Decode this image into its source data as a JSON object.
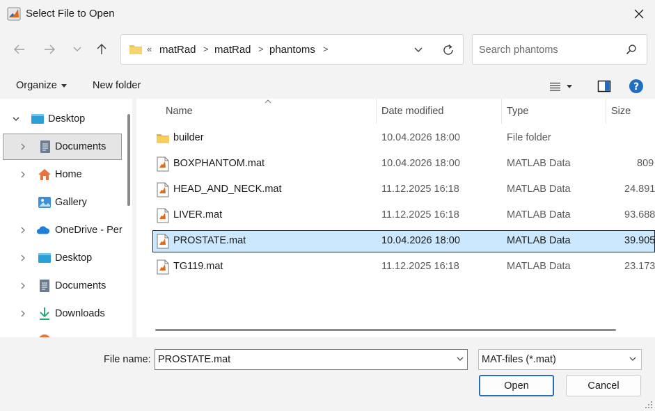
{
  "window": {
    "title": "Select File to Open"
  },
  "address": {
    "overflow": "«",
    "crumbs": [
      "matRad",
      "matRad",
      "phantoms"
    ],
    "separator": ">"
  },
  "search": {
    "placeholder": "Search phantoms"
  },
  "toolbar": {
    "organize_label": "Organize",
    "new_folder_label": "New folder"
  },
  "nav": {
    "items": [
      {
        "label": "Desktop",
        "icon": "desktop-icon",
        "expanded": true
      },
      {
        "label": "Documents",
        "icon": "documents-icon",
        "selected": true
      },
      {
        "label": "Home",
        "icon": "home-icon"
      },
      {
        "label": "Gallery",
        "icon": "gallery-icon"
      },
      {
        "label": "OneDrive - Per",
        "icon": "onedrive-icon"
      },
      {
        "label": "Desktop",
        "icon": "desktop-icon"
      },
      {
        "label": "Documents",
        "icon": "documents-icon"
      },
      {
        "label": "Downloads",
        "icon": "downloads-icon"
      }
    ]
  },
  "columns": {
    "name": "Name",
    "date": "Date modified",
    "type": "Type",
    "size": "Size"
  },
  "files": [
    {
      "name": "builder",
      "date": "10.04.2026 18:00",
      "type": "File folder",
      "size": "",
      "icon": "folder-icon"
    },
    {
      "name": "BOXPHANTOM.mat",
      "date": "10.04.2026 18:00",
      "type": "MATLAB Data",
      "size": "809",
      "icon": "matlab-file-icon"
    },
    {
      "name": "HEAD_AND_NECK.mat",
      "date": "11.12.2025 16:18",
      "type": "MATLAB Data",
      "size": "24.891",
      "icon": "matlab-file-icon"
    },
    {
      "name": "LIVER.mat",
      "date": "11.12.2025 16:18",
      "type": "MATLAB Data",
      "size": "93.688",
      "icon": "matlab-file-icon"
    },
    {
      "name": "PROSTATE.mat",
      "date": "10.04.2026 18:00",
      "type": "MATLAB Data",
      "size": "39.905",
      "icon": "matlab-file-icon",
      "selected": true
    },
    {
      "name": "TG119.mat",
      "date": "11.12.2025 16:18",
      "type": "MATLAB Data",
      "size": "23.173",
      "icon": "matlab-file-icon"
    }
  ],
  "footer": {
    "file_name_label": "File name:",
    "file_name_value": "PROSTATE.mat",
    "file_type": "MAT-files (*.mat)",
    "open_label": "Open",
    "cancel_label": "Cancel"
  },
  "colors": {
    "accent": "#1f6ec4",
    "selection": "#cce8ff",
    "folder": "#f2c14e"
  }
}
